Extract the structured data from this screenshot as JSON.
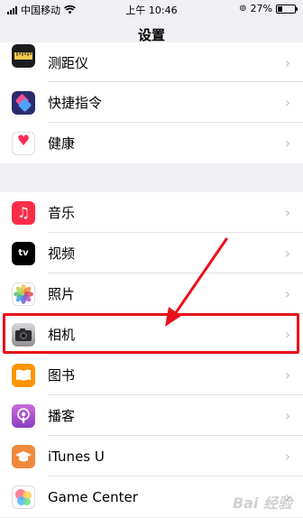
{
  "status_bar": {
    "carrier": "中国移动",
    "time": "上午 10:46",
    "battery": "27%",
    "battery_level": 0.27
  },
  "header": {
    "title": "设置"
  },
  "group1": [
    {
      "label": "测距仪",
      "icon": "measure-icon",
      "color": "#1c1c1e"
    },
    {
      "label": "快捷指令",
      "icon": "shortcuts-icon",
      "color": "#2c2c6e"
    },
    {
      "label": "健康",
      "icon": "health-heart-icon",
      "color": "#ff2d55"
    }
  ],
  "group2": [
    {
      "label": "音乐",
      "icon": "music-icon",
      "color": "#fa2d48"
    },
    {
      "label": "视频",
      "icon": "tv-icon",
      "color": "#000000",
      "badge": "tv"
    },
    {
      "label": "照片",
      "icon": "photos-icon",
      "color": "#ffffff"
    },
    {
      "label": "相机",
      "icon": "camera-icon",
      "color": "#8e8e93"
    },
    {
      "label": "图书",
      "icon": "books-icon",
      "color": "#ff9500"
    },
    {
      "label": "播客",
      "icon": "podcasts-icon",
      "color": "#9b4fdc"
    },
    {
      "label": "iTunes U",
      "icon": "itunes-u-icon",
      "color": "#f0893c"
    },
    {
      "label": "Game Center",
      "icon": "game-center-icon",
      "color": "#ffffff"
    }
  ],
  "accent": {
    "highlight": "#e8111b",
    "chevron": "#c4c4c8"
  }
}
